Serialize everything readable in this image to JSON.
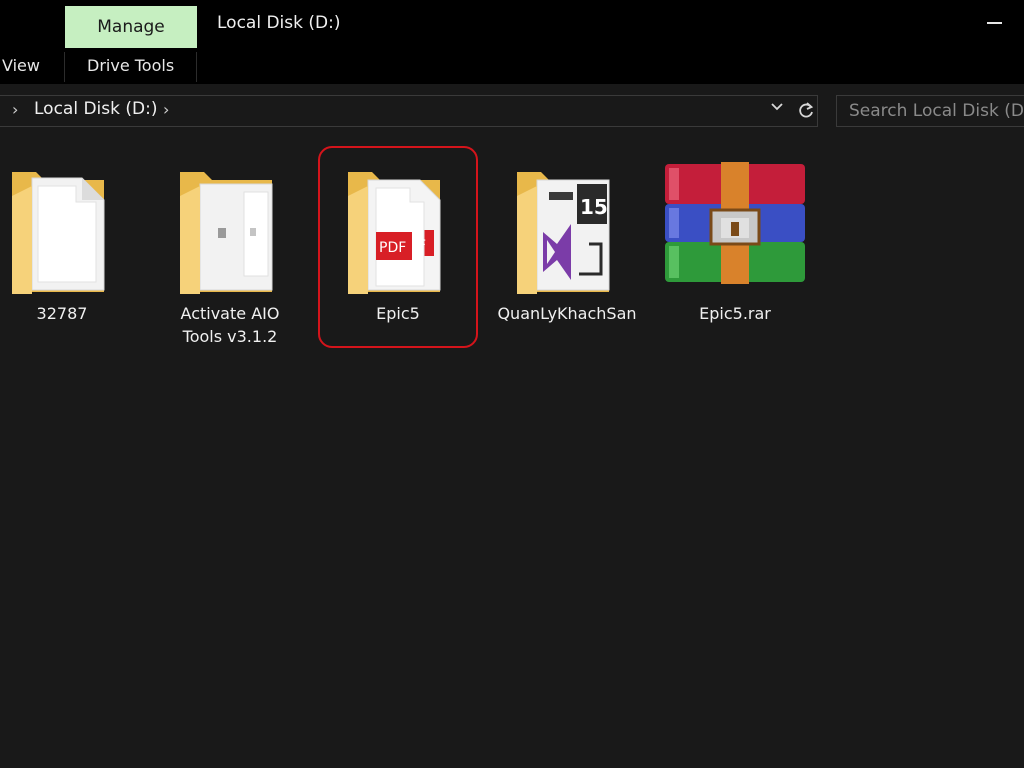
{
  "window": {
    "title": "Local Disk (D:)",
    "manage_tab": "Manage"
  },
  "ribbon": {
    "tabs": [
      "View",
      "Drive Tools"
    ]
  },
  "address": {
    "path": "Local Disk (D:)"
  },
  "search": {
    "placeholder": "Search Local Disk (D:)"
  },
  "items": [
    {
      "name": "32787",
      "type": "folder",
      "icon": "folder-icon"
    },
    {
      "name": "Activate AIO Tools v3.1.2",
      "type": "folder",
      "icon": "folder-icon"
    },
    {
      "name": "Epic5",
      "type": "folder",
      "icon": "folder-pdf-icon",
      "highlighted": true
    },
    {
      "name": "QuanLyKhachSan",
      "type": "folder",
      "icon": "folder-visual-studio-icon"
    },
    {
      "name": "Epic5.rar",
      "type": "archive",
      "icon": "winrar-archive-icon"
    }
  ],
  "colors": {
    "manage_tab_bg": "#c6efc1",
    "highlight_border": "#d4141b",
    "folder_yellow": "#f6d27a",
    "background": "#191919"
  }
}
